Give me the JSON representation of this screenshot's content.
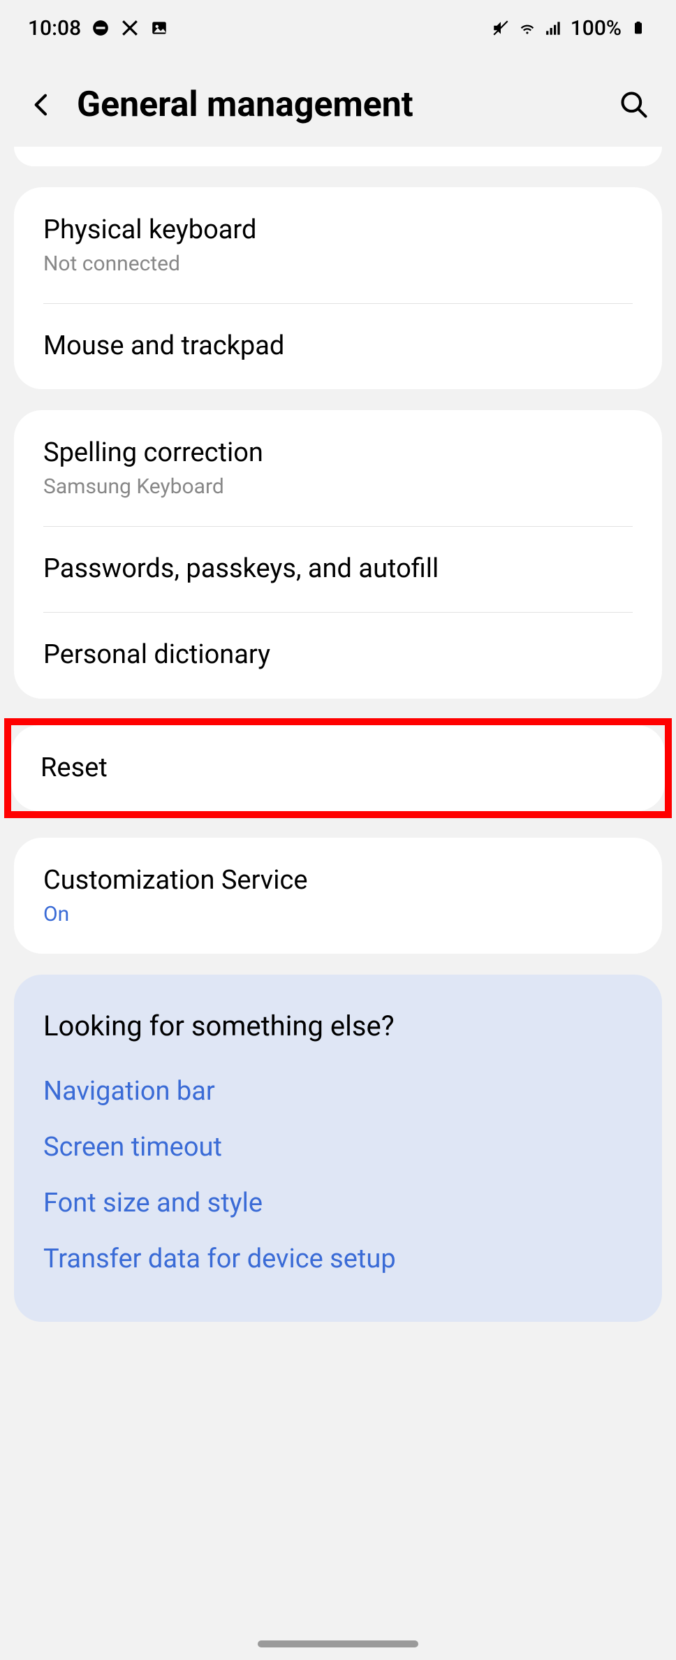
{
  "status": {
    "time": "10:08",
    "battery": "100%"
  },
  "header": {
    "title": "General management"
  },
  "group1": [
    {
      "title": "Physical keyboard",
      "sub": "Not connected"
    },
    {
      "title": "Mouse and trackpad"
    }
  ],
  "group2": [
    {
      "title": "Spelling correction",
      "sub": "Samsung Keyboard"
    },
    {
      "title": "Passwords, passkeys, and autofill"
    },
    {
      "title": "Personal dictionary"
    }
  ],
  "group3": [
    {
      "title": "Reset"
    }
  ],
  "group4": [
    {
      "title": "Customization Service",
      "sub": "On",
      "subStyle": "blue"
    }
  ],
  "suggestions": {
    "heading": "Looking for something else?",
    "links": [
      "Navigation bar",
      "Screen timeout",
      "Font size and style",
      "Transfer data for device setup"
    ]
  }
}
